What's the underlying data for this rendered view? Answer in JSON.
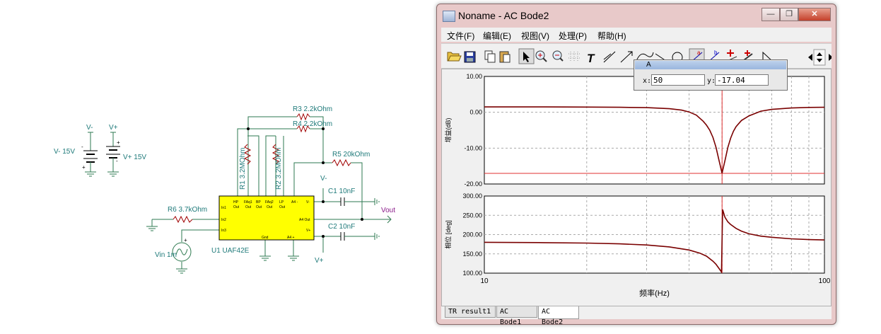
{
  "window": {
    "title": "Noname - AC Bode2",
    "minimize": "—",
    "restore": "❐",
    "close": "✕"
  },
  "menu": [
    "文件(F)",
    "编辑(E)",
    "视图(V)",
    "处理(P)",
    "帮助(H)"
  ],
  "toolbar_icons": [
    "open-folder-icon",
    "save-icon",
    "copy-icon",
    "paste-icon",
    "pointer-icon",
    "zoom-in-icon",
    "zoom-out-icon",
    "grid-icon",
    "text-tool-icon",
    "line-tool-icon",
    "arrow-tool-icon",
    "curve-tool-icon",
    "diagonal-line-icon",
    "circle-tool-icon",
    "cursor-a-icon",
    "cursor-b-icon",
    "marker-add-icon",
    "marker-pen-icon",
    "triangle-tool-icon",
    "scroll-left-icon",
    "scroll-up-down-icon",
    "scroll-right-icon"
  ],
  "cursor_dialog": {
    "title": "A",
    "x_label": "x:",
    "x_value": "50",
    "y_label": "y:",
    "y_value": "-17.04"
  },
  "tabs": [
    "TR result1",
    "AC Bode1",
    "AC Bode2"
  ],
  "active_tab": "AC Bode2",
  "schematic": {
    "labels": {
      "vminus_top": "V-",
      "vplus_top": "V+",
      "vminus_left": "V- 15V",
      "vplus_right": "V+ 15V",
      "r3": "R3 2.2kOhm",
      "r4": "R4 2.2kOhm",
      "r5": "R5 20kOhm",
      "r1": "R1 3.2MOhm",
      "r2": "R2 3.2MOhm",
      "r6": "R6 3.7kOhm",
      "c1": "C1 10nF",
      "c2": "C2 10nF",
      "vminus_c1": "V-",
      "vplus_c2": "V+",
      "vout": "Vout",
      "vin": "Vin 1m",
      "u1": "U1 UAF42E",
      "plus": "+",
      "minus": "-"
    },
    "pins": {
      "hp": "HP",
      "hp_out": "Out",
      "faq1": "FAq1",
      "faq1_out": "Out",
      "bp": "BP",
      "bp_out": "Out",
      "faq2": "FAq2",
      "faq2_out": "Out",
      "lp": "LP",
      "lp_out": "Out",
      "a4minus": "A4 -",
      "vminus": "V-",
      "in1": "In1",
      "in2": "In2",
      "in3": "In3",
      "a4out": "A4 Out",
      "vplus": "V+",
      "gnd": "Gnd",
      "a4plus": "A4 +"
    }
  },
  "chart_data": [
    {
      "type": "line",
      "title": "",
      "xlabel": "",
      "ylabel": "增益(dB)",
      "xscale": "log",
      "xlim": [
        10,
        100
      ],
      "ylim": [
        -20,
        10
      ],
      "yticks": [
        "10.00",
        "0.00",
        "-10.00",
        "-20.00"
      ],
      "grid": true,
      "color": "#7a0000",
      "cursor": {
        "x": 50,
        "y": -17.04,
        "color": "#e03030"
      },
      "series": [
        {
          "x": [
            10,
            15,
            20,
            25,
            30,
            35,
            38,
            40,
            42,
            44,
            45,
            46,
            47,
            48,
            49,
            50,
            51,
            52,
            53,
            54,
            55,
            57,
            60,
            65,
            70,
            80,
            90,
            100
          ],
          "y": [
            1.5,
            1.5,
            1.45,
            1.4,
            1.3,
            1.0,
            0.6,
            0.1,
            -0.8,
            -2.5,
            -3.6,
            -5.0,
            -7.0,
            -9.8,
            -13.5,
            -17.0,
            -13.5,
            -9.8,
            -7.2,
            -5.3,
            -4.0,
            -2.3,
            -1.0,
            0.3,
            0.8,
            1.2,
            1.35,
            1.4
          ]
        }
      ]
    },
    {
      "type": "line",
      "title": "",
      "xlabel": "频率(Hz)",
      "ylabel": "相位 [deg]",
      "xscale": "log",
      "xlim": [
        10,
        100
      ],
      "ylim": [
        100,
        300
      ],
      "yticks": [
        "300.00",
        "250.00",
        "200.00",
        "150.00",
        "100.00"
      ],
      "xticks": [
        "10",
        "100"
      ],
      "grid": true,
      "color": "#7a0000",
      "cursor": {
        "x": 50,
        "color": "#e03030"
      },
      "series": [
        {
          "x": [
            10,
            15,
            20,
            25,
            30,
            35,
            40,
            43,
            45,
            47,
            48,
            49,
            49.8,
            50.2,
            51,
            52,
            53,
            55,
            57,
            60,
            65,
            70,
            80,
            90,
            100
          ],
          "y": [
            180,
            179,
            178,
            176,
            173,
            168,
            160,
            152,
            144,
            131,
            123,
            112,
            103,
            265,
            245,
            233,
            226,
            216,
            209,
            202,
            196,
            193,
            189,
            187,
            186
          ]
        }
      ]
    }
  ]
}
